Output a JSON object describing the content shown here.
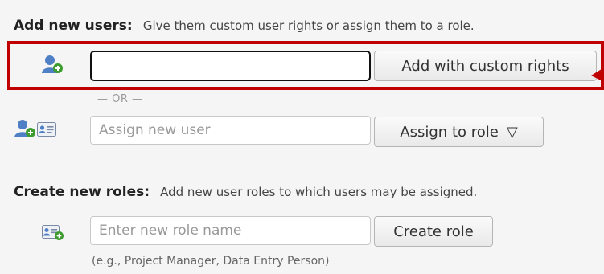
{
  "add_users": {
    "heading": "Add new users:",
    "description": "Give them custom user rights or assign them to a role.",
    "custom_input_value": "",
    "custom_button_label": "Add with custom rights",
    "or_label": "— OR —",
    "assign_placeholder": "Assign new user",
    "assign_button_label": "Assign to role",
    "assign_button_caret": "▽"
  },
  "create_roles": {
    "heading": "Create new roles:",
    "description": "Add new user roles to which users may be assigned.",
    "role_placeholder": "Enter new role name",
    "create_button_label": "Create role",
    "hint": "(e.g., Project Manager, Data Entry Person)"
  },
  "icons": {
    "add_user": "user-add-icon",
    "assign_user": "user-add-icon",
    "user_card": "id-card-icon",
    "add_role": "id-card-add-icon"
  },
  "colors": {
    "highlight": "#c00000",
    "background": "#f5f5f5",
    "user_icon_blue": "#4f7fc4",
    "add_badge_green": "#3d9b2f"
  }
}
